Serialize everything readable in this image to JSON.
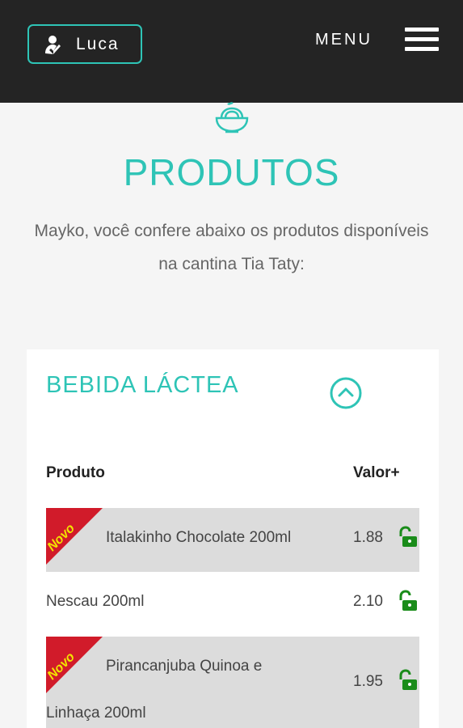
{
  "header": {
    "user_name": "Luca",
    "menu_label": "MENU"
  },
  "page": {
    "title": "PRODUTOS",
    "intro": "Mayko, você confere abaixo os produtos disponíveis na cantina Tia Taty:"
  },
  "category": {
    "title": "BEBIDA LÁCTEA",
    "columns": {
      "product": "Produto",
      "value": "Valor+"
    },
    "items": [
      {
        "name": "Italakinho Chocolate 200ml",
        "price": "1.88",
        "badge": "Novo"
      },
      {
        "name": "Nescau 200ml",
        "price": "2.10"
      },
      {
        "name_line1": "Pirancanjuba Quinoa e",
        "name_line2": "Linhaça 200ml",
        "price": "1.95",
        "badge": "Novo"
      }
    ]
  },
  "colors": {
    "accent": "#2ec4b6",
    "header_bg": "#242424",
    "lock_green": "#1a8c1a",
    "ribbon_red": "#d11b2a",
    "ribbon_text": "#f2e400"
  },
  "icons": [
    "user-check-icon",
    "hamburger-icon",
    "noodle-bowl-icon",
    "chevron-up-circle-icon",
    "unlock-icon"
  ]
}
